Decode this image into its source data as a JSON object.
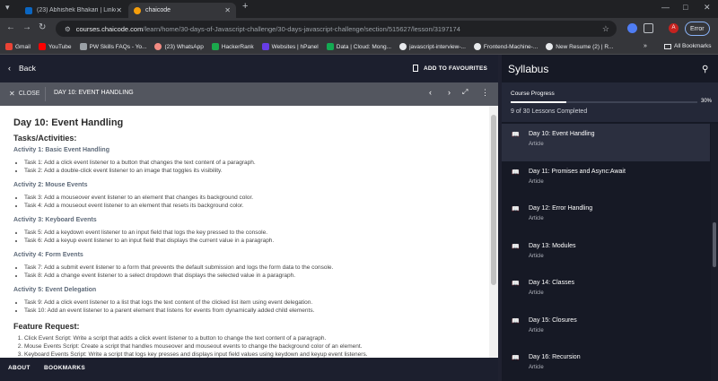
{
  "browser": {
    "tabs": [
      {
        "title": "(23) Abhishek Bhakari | Linked",
        "favicon": "linkedin-icon"
      },
      {
        "title": "chaicode",
        "favicon": "chaicode-icon",
        "active": true
      }
    ],
    "new_tab": "+",
    "window_controls": [
      "—",
      "□",
      "✕"
    ],
    "url_host": "courses.chaicode.com",
    "url_path": "/learn/home/30-days-of-Javascript-challenge/30-days-javascript-challenge/section/515627/lesson/3197174",
    "profile_initial": "A",
    "error_label": "Error",
    "bookmarks": [
      {
        "label": "Gmail",
        "color": "#ea4335"
      },
      {
        "label": "YouTube",
        "color": "#ff0000"
      },
      {
        "label": "PW Skills FAQs - Yo...",
        "color": "#9aa0a6"
      },
      {
        "label": "(23) WhatsApp",
        "color": "#f28b82"
      },
      {
        "label": "HackerRank",
        "color": "#1ba94c"
      },
      {
        "label": "Websites | hPanel",
        "color": "#673de6"
      },
      {
        "label": "Data | Cloud: Mong...",
        "color": "#13aa52"
      },
      {
        "label": "javascript-interview-...",
        "color": "#e8eaed"
      },
      {
        "label": "Frontend-Machine-...",
        "color": "#e8eaed"
      },
      {
        "label": "New Resume (2) | R...",
        "color": "#e8eaed"
      }
    ],
    "bookmarks_more": "»",
    "all_bookmarks": "All Bookmarks"
  },
  "lesson": {
    "back_label": "Back",
    "favourites_label": "ADD TO FAVOURITES",
    "close_label": "CLOSE",
    "header_title": "DAY 10: EVENT HANDLING",
    "title": "Day 10: Event Handling",
    "tasks_heading": "Tasks/Activities:",
    "activities": [
      {
        "title": "Activity 1: Basic Event Handling",
        "tasks": [
          "Task 1: Add a click event listener to a button that changes the text content of a paragraph.",
          "Task 2: Add a double-click event listener to an image that toggles its visibility."
        ]
      },
      {
        "title": "Activity 2: Mouse Events",
        "tasks": [
          "Task 3: Add a mouseover event listener to an element that changes its background color.",
          "Task 4: Add a mouseout event listener to an element that resets its background color."
        ]
      },
      {
        "title": "Activity 3: Keyboard Events",
        "tasks": [
          "Task 5: Add a keydown event listener to an input field that logs the key pressed to the console.",
          "Task 6: Add a keyup event listener to an input field that displays the current value in a paragraph."
        ]
      },
      {
        "title": "Activity 4: Form Events",
        "tasks": [
          "Task 7: Add a submit event listener to a form that prevents the default submission and logs the form data to the console.",
          "Task 8: Add a change event listener to a select dropdown that displays the selected value in a paragraph."
        ]
      },
      {
        "title": "Activity 5: Event Delegation",
        "tasks": [
          "Task 9: Add a click event listener to a list that logs the text content of the clicked list item using event delegation.",
          "Task 10: Add an event listener to a parent element that listens for events from dynamically added child elements."
        ]
      }
    ],
    "feature_heading": "Feature Request:",
    "features": [
      "Click Event Script: Write a script that adds a click event listener to a button to change the text content of a paragraph.",
      "Mouse Events Script: Create a script that handles mouseover and mouseout events to change the background color of an element.",
      "Keyboard Events Script: Write a script that logs key presses and displays input field values using keydown and keyup event listeners."
    ],
    "footer": {
      "about": "ABOUT",
      "bookmarks": "BOOKMARKS"
    }
  },
  "syllabus": {
    "title": "Syllabus",
    "progress_label": "Course Progress",
    "progress_fraction": 0.3,
    "progress_text": "30%",
    "lessons_completed": "9 of 30 Lessons Completed",
    "items": [
      {
        "name": "Day 10: Event Handling",
        "type": "Article",
        "active": true
      },
      {
        "name": "Day 11: Promises and Async:Await",
        "type": "Article"
      },
      {
        "name": "Day 12: Error Handling",
        "type": "Article"
      },
      {
        "name": "Day 13: Modules",
        "type": "Article"
      },
      {
        "name": "Day 14: Classes",
        "type": "Article"
      },
      {
        "name": "Day 15: Closures",
        "type": "Article"
      },
      {
        "name": "Day 16: Recursion",
        "type": "Article"
      }
    ]
  }
}
